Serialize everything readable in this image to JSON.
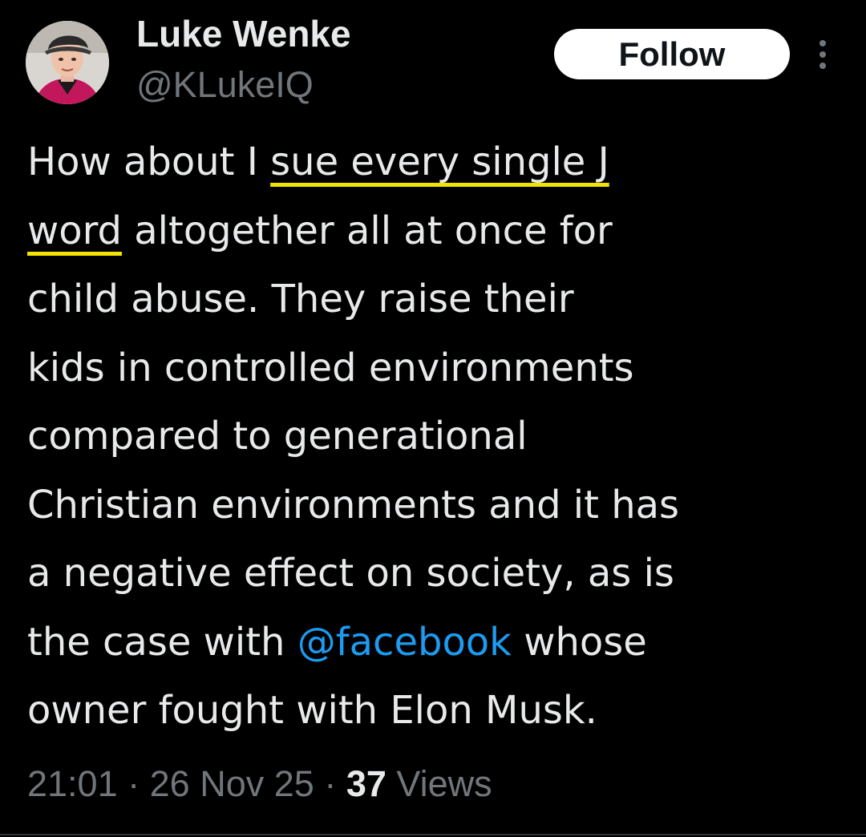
{
  "author": {
    "display_name": "Luke Wenke",
    "handle": "@KLukeIQ",
    "avatar_icon": "profile-photo"
  },
  "follow_button": {
    "label": "Follow"
  },
  "more_menu": {
    "icon": "more-vertical-icon"
  },
  "tweet": {
    "lines": [
      [
        "How about I ",
        {
          "text": "sue every single J",
          "highlight": true
        }
      ],
      [
        {
          "text": "word",
          "highlight": true
        },
        " altogether all at once for"
      ],
      [
        "child abuse.  They raise their"
      ],
      [
        "kids in controlled environments"
      ],
      [
        "compared to generational"
      ],
      [
        "Christian environments and it has"
      ],
      [
        "a negative effect on society, as is"
      ],
      [
        "the case with ",
        {
          "text": "@facebook",
          "mention": true
        },
        " whose"
      ],
      [
        "owner fought with Elon Musk."
      ]
    ],
    "highlight_color": "#f2e300",
    "mention_color": "#1d9bf0"
  },
  "meta": {
    "time": "21:01",
    "separator": "·",
    "date": "26 Nov 25",
    "views_count": "37",
    "views_label": "Views"
  }
}
